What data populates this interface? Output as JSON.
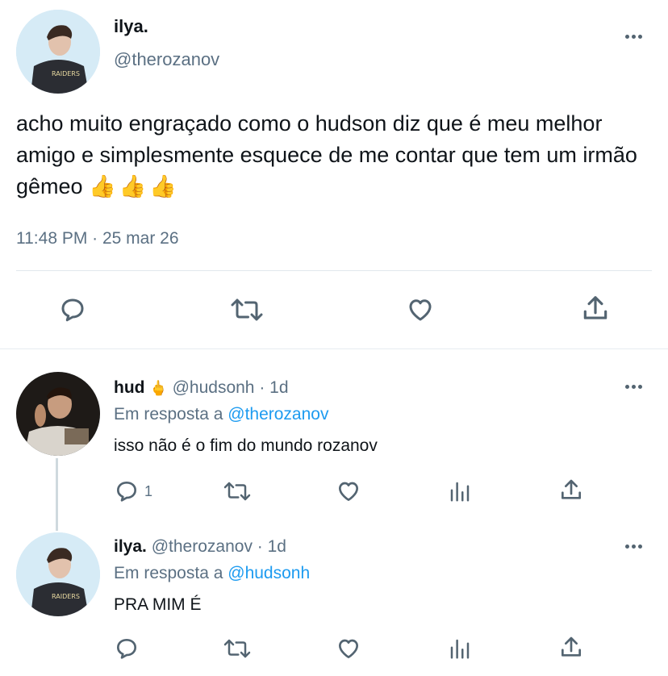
{
  "main_tweet": {
    "display_name": "ilya.",
    "handle": "@therozanov",
    "text": "acho muito engraçado como o hudson diz que é meu melhor amigo e simplesmente esquece de me contar que tem um irmão gêmeo",
    "emoji": "👍👍👍",
    "timestamp": "11:48 PM · 25 mar 26",
    "actions": [
      "reply-icon",
      "retweet-icon",
      "like-icon",
      "share-icon"
    ]
  },
  "replies": [
    {
      "display_name": "hud",
      "name_emoji": "🖕",
      "handle": "@hudsonh",
      "age": "· 1d",
      "reply_prefix": "Em resposta a",
      "reply_to": "@therozanov",
      "text": "isso não é o fim do mundo rozanov",
      "reply_count": "1"
    },
    {
      "display_name": "ilya.",
      "handle": "@therozanov",
      "age": "· 1d",
      "reply_prefix": "Em resposta a",
      "reply_to": "@hudsonh",
      "text": "PRA MIM É",
      "reply_count": ""
    }
  ],
  "colors": {
    "text": "#0f1419",
    "secondary": "#5b7083",
    "link": "#1d9bf0",
    "divider": "#e1e8ed"
  }
}
